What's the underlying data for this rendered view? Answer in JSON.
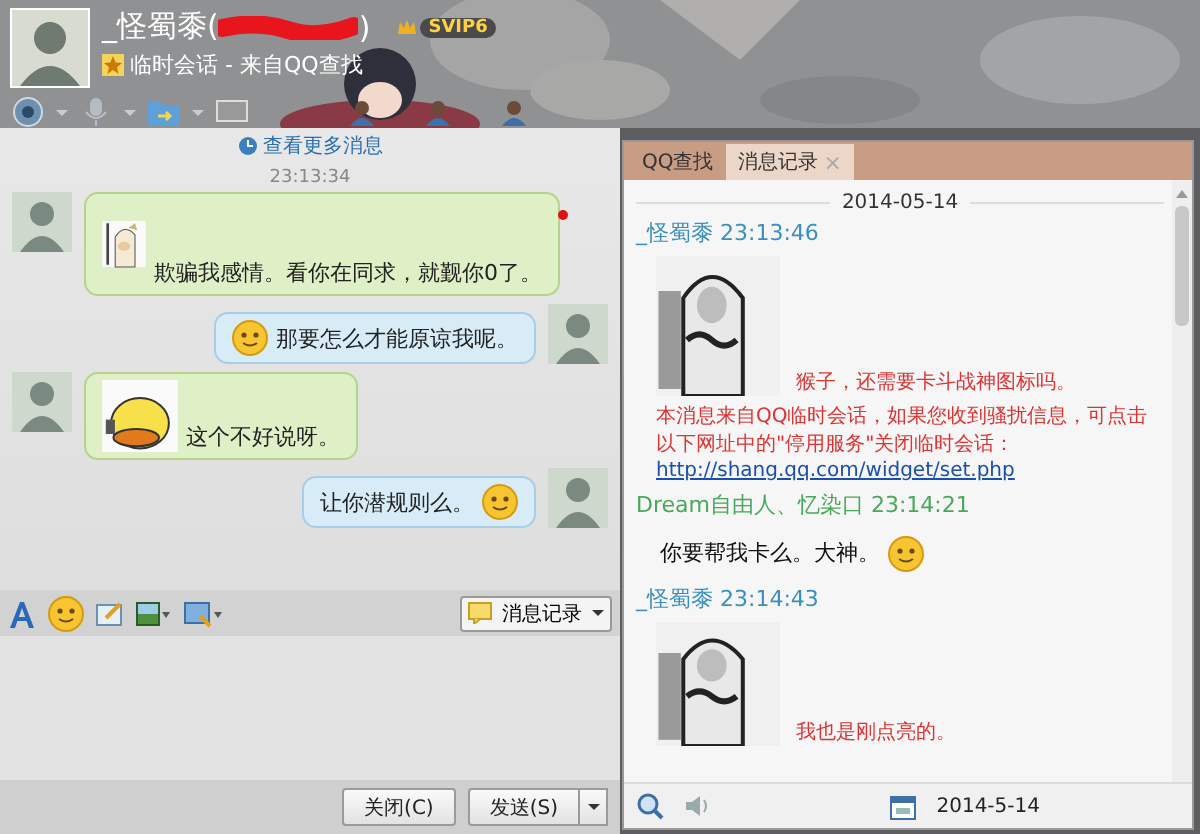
{
  "header": {
    "title_before": "_怪蜀黍(",
    "title_after": ")",
    "badge": "SVIP6",
    "subtitle": "临时会话 - 来自QQ查找"
  },
  "chat": {
    "more_link": "查看更多消息",
    "time": "23:13:34",
    "messages": [
      {
        "outgoing": false,
        "kind": "sticker",
        "text": "欺骗我感情。看你在同求，就觐你0了。"
      },
      {
        "outgoing": true,
        "kind": "emoji_first",
        "text": "那要怎么才能原谅我呢。"
      },
      {
        "outgoing": false,
        "kind": "sticker",
        "text": "这个不好说呀。"
      },
      {
        "outgoing": true,
        "kind": "emoji_last",
        "text": "让你潜规则么。"
      }
    ]
  },
  "toolbar": {
    "history_button": "消息记录"
  },
  "buttons": [
    {
      "label": "关闭(C)",
      "menu": false
    },
    {
      "label": "发送(S)",
      "menu": true
    }
  ],
  "history": {
    "tabs": [
      {
        "label": "QQ查找",
        "selected": false
      },
      {
        "label": "消息记录",
        "selected": true,
        "close": "×"
      }
    ],
    "date": "2014-05-14",
    "entries": [
      {
        "kind": "header",
        "name": "_怪蜀黍",
        "time": "23:13:46",
        "color": "#3a8fc0"
      },
      {
        "kind": "sticker",
        "text": "猴子，还需要卡斗战神图标吗。"
      },
      {
        "kind": "system",
        "text": "本消息来自QQ临时会话，如果您收到骚扰信息，可点击以下网址中的\"停用服务\"关闭临时会话：",
        "link": "http://shang.qq.com/widget/set.php"
      },
      {
        "kind": "header",
        "name": "Dream自由人、忆染口",
        "time": "23:14:21",
        "color": "#4aa85a"
      },
      {
        "kind": "text",
        "text": "你要帮我卡么。大神。"
      },
      {
        "kind": "header",
        "name": "_怪蜀黍",
        "time": "23:14:43",
        "color": "#3a8fc0"
      },
      {
        "kind": "sticker",
        "text": "我也是刚点亮的。"
      }
    ],
    "footer_date": "2014-5-14"
  }
}
